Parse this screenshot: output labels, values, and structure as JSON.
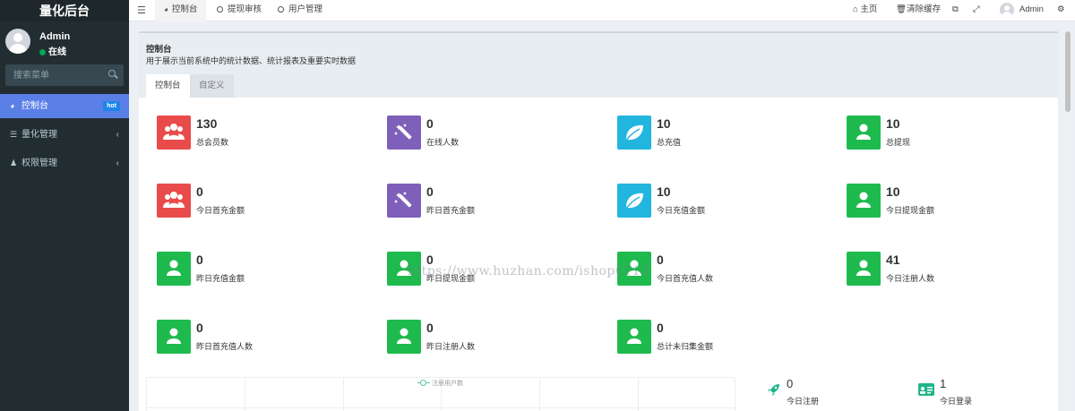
{
  "sidebar": {
    "title": "量化后台",
    "user": {
      "name": "Admin",
      "status": "在线"
    },
    "search_placeholder": "搜索菜单",
    "items": [
      {
        "label": "控制台",
        "badge": "hot"
      },
      {
        "label": "量化管理"
      },
      {
        "label": "权限管理"
      }
    ]
  },
  "topbar": {
    "tabs": [
      {
        "label": "控制台"
      },
      {
        "label": "提现审核"
      },
      {
        "label": "用户管理"
      }
    ],
    "home_label": "主页",
    "clear_cache_label": "清除缓存",
    "user_name": "Admin"
  },
  "content": {
    "title": "控制台",
    "description": "用于展示当前系统中的统计数据、统计报表及重要实时数据",
    "tabs": [
      "控制台",
      "自定义"
    ],
    "stats": [
      {
        "value": "130",
        "label": "总会员数",
        "color": "#e94b4b",
        "icon": "users-icon"
      },
      {
        "value": "0",
        "label": "在线人数",
        "color": "#7e5fba",
        "icon": "magic-icon"
      },
      {
        "value": "10",
        "label": "总充值",
        "color": "#22b5de",
        "icon": "leaf-icon"
      },
      {
        "value": "10",
        "label": "总提现",
        "color": "#1fba4e",
        "icon": "user-icon"
      },
      {
        "value": "0",
        "label": "今日首充金额",
        "color": "#e94b4b",
        "icon": "users-icon"
      },
      {
        "value": "0",
        "label": "昨日首充金额",
        "color": "#7e5fba",
        "icon": "magic-icon"
      },
      {
        "value": "10",
        "label": "今日充值金额",
        "color": "#22b5de",
        "icon": "leaf-icon"
      },
      {
        "value": "10",
        "label": "今日提现金额",
        "color": "#1fba4e",
        "icon": "user-icon"
      },
      {
        "value": "0",
        "label": "昨日充值金额",
        "color": "#1fba4e",
        "icon": "user-icon"
      },
      {
        "value": "0",
        "label": "昨日提现金额",
        "color": "#1fba4e",
        "icon": "user-icon"
      },
      {
        "value": "0",
        "label": "今日首充值人数",
        "color": "#1fba4e",
        "icon": "user-icon"
      },
      {
        "value": "41",
        "label": "今日注册人数",
        "color": "#1fba4e",
        "icon": "user-icon"
      },
      {
        "value": "0",
        "label": "昨日首充值人数",
        "color": "#1fba4e",
        "icon": "user-icon"
      },
      {
        "value": "0",
        "label": "昨日注册人数",
        "color": "#1fba4e",
        "icon": "user-icon"
      },
      {
        "value": "0",
        "label": "总计未归集金额",
        "color": "#1fba4e",
        "icon": "user-icon"
      }
    ],
    "chart_legend": "注册用户数",
    "mini_stats": [
      {
        "value": "0",
        "label": "今日注册",
        "icon": "rocket-icon"
      },
      {
        "value": "1",
        "label": "今日登录",
        "icon": "id-card-icon"
      }
    ]
  },
  "watermark": "https://www.huzhan.com/ishop6113"
}
